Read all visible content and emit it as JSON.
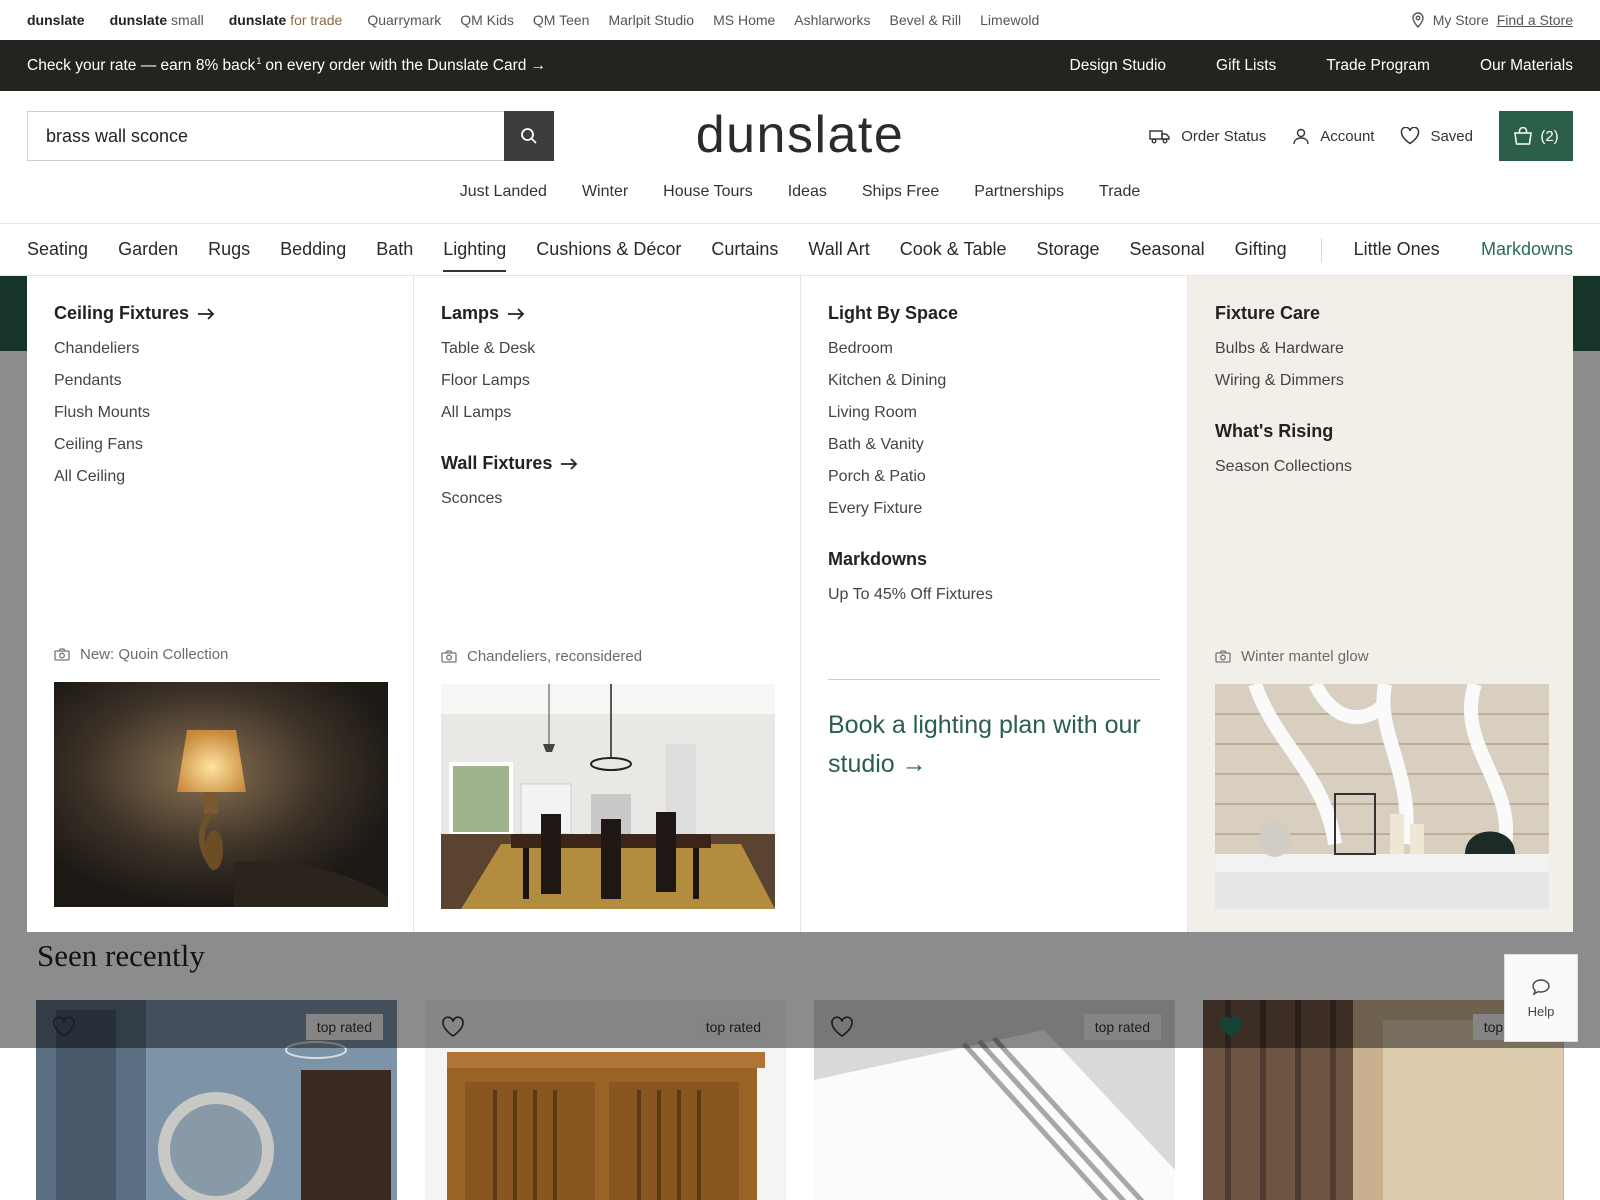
{
  "brandbar": {
    "brands": [
      {
        "main": "dunslate",
        "sub": ""
      },
      {
        "main": "dunslate",
        "sub": "small"
      },
      {
        "main": "dunslate",
        "sub": "for trade"
      }
    ],
    "sisters": [
      "Quarrymark",
      "QM Kids",
      "QM Teen",
      "Marlpit Studio",
      "MS Home",
      "Ashlarworks",
      "Bevel & Rill",
      "Limewold"
    ],
    "my_store": "My Store",
    "find_store": "Find a Store"
  },
  "promo": {
    "text_before": "Check your rate — earn 8% back",
    "footnote": "1",
    "text_after": "on every order with the Dunslate Card →",
    "links": [
      "Design Studio",
      "Gift Lists",
      "Trade Program",
      "Our Materials"
    ]
  },
  "header": {
    "search_value": "brass wall sconce",
    "logo": "dunslate",
    "order_status": "Order Status",
    "account": "Account",
    "saved": "Saved",
    "cart_count": "(2)",
    "subnav": [
      "Just Landed",
      "Winter",
      "House Tours",
      "Ideas",
      "Ships Free",
      "Partnerships",
      "Trade"
    ]
  },
  "catnav": {
    "items": [
      "Seating",
      "Garden",
      "Rugs",
      "Bedding",
      "Bath",
      "Lighting",
      "Cushions & Décor",
      "Curtains",
      "Wall Art",
      "Cook & Table",
      "Storage",
      "Seasonal",
      "Gifting"
    ],
    "active": "Lighting",
    "little_ones": "Little Ones",
    "markdowns": "Markdowns"
  },
  "mega": {
    "col1": {
      "heading": "Ceiling Fixtures",
      "links": [
        "Chandeliers",
        "Pendants",
        "Flush Mounts",
        "Ceiling Fans",
        "All Ceiling"
      ],
      "caption": "New: Quoin Collection"
    },
    "col2": {
      "heading1": "Lamps",
      "links1": [
        "Table & Desk",
        "Floor Lamps",
        "All Lamps"
      ],
      "heading2": "Wall Fixtures",
      "links2": [
        "Sconces"
      ],
      "caption": "Chandeliers, reconsidered"
    },
    "col3": {
      "heading1": "Light By Space",
      "links1": [
        "Bedroom",
        "Kitchen & Dining",
        "Living Room",
        "Bath & Vanity",
        "Porch & Patio",
        "Every Fixture"
      ],
      "heading2": "Markdowns",
      "links2": [
        "Up To 45% Off Fixtures"
      ],
      "cta": "Book a lighting plan with our studio →"
    },
    "col4": {
      "heading1": "Fixture Care",
      "links1": [
        "Bulbs & Hardware",
        "Wiring & Dimmers"
      ],
      "heading2": "What's Rising",
      "links2": [
        "Season Collections"
      ],
      "caption": "Winter mantel glow"
    }
  },
  "recent": {
    "title": "Seen recently",
    "badge": "top rated",
    "help": "Help"
  },
  "colors": {
    "accent_green": "#2b5f4a",
    "promo_bg": "#24231f",
    "trade_text": "#8a6a3c"
  }
}
